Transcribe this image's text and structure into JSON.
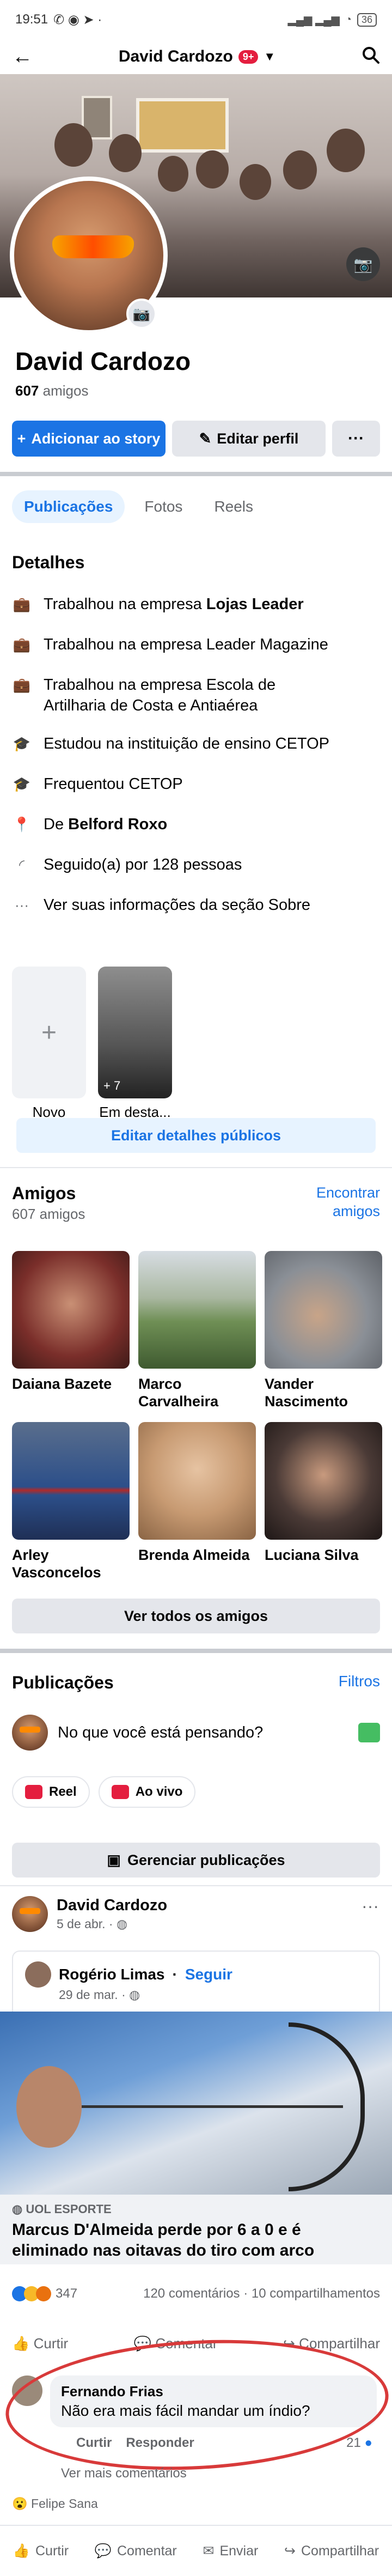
{
  "status_bar": {
    "time": "19:51",
    "battery": "36"
  },
  "nav": {
    "title": "David Cardozo",
    "badge": "9+"
  },
  "profile": {
    "name": "David Cardozo",
    "friend_count": "607",
    "friends_label": "amigos",
    "add_story_label": "Adicionar ao story",
    "edit_profile_label": "Editar perfil",
    "more_label": "···"
  },
  "tabs": [
    {
      "label": "Publicações",
      "active": true
    },
    {
      "label": "Fotos",
      "active": false
    },
    {
      "label": "Reels",
      "active": false
    }
  ],
  "details": {
    "title": "Detalhes",
    "items": [
      {
        "icon": "briefcase-icon",
        "text": "Trabalhou na empresa ",
        "bold": "Lojas Leader"
      },
      {
        "icon": "briefcase-icon",
        "text": "Trabalhou na empresa Leader Magazine",
        "bold": ""
      },
      {
        "icon": "briefcase-icon",
        "text": "Trabalhou na empresa Escola de Artilharia de Costa e Antiaérea",
        "bold": ""
      },
      {
        "icon": "graduation-cap-icon",
        "text": "Estudou na instituição de ensino CETOP",
        "bold": ""
      },
      {
        "icon": "graduation-cap-icon",
        "text": "Frequentou CETOP",
        "bold": ""
      },
      {
        "icon": "location-pin-icon",
        "text": "De ",
        "bold": "Belford Roxo"
      },
      {
        "icon": "rss-icon",
        "text": "Seguido(a) por 128 pessoas",
        "bold": ""
      },
      {
        "icon": "ellipsis-icon",
        "text": "Ver suas informações da seção Sobre",
        "bold": ""
      }
    ]
  },
  "highlights": {
    "items": [
      {
        "label": "Novo",
        "symbol": "+"
      },
      {
        "label": "Em desta...",
        "count": "+ 7"
      }
    ],
    "edit_label": "Editar detalhes públicos"
  },
  "friends": {
    "title": "Amigos",
    "count": "607 amigos",
    "find_label": "Encontrar amigos",
    "see_all_label": "Ver todos os amigos",
    "list": [
      {
        "name": "Daiana Bazete",
        "color": "#7a2e2a"
      },
      {
        "name": "Marco Carvalheira",
        "color": "#6f8f55"
      },
      {
        "name": "Vander Nascimento",
        "color": "#8a8f96"
      },
      {
        "name": "Arley Vasconcelos",
        "color": "#2c4f8a"
      },
      {
        "name": "Brenda Almeida",
        "color": "#c79a72"
      },
      {
        "name": "Luciana Silva",
        "color": "#4a3a36"
      }
    ]
  },
  "posts": {
    "title": "Publicações",
    "filters_label": "Filtros",
    "composer_placeholder": "No que você está pensando?",
    "reel_label": "Reel",
    "live_label": "Ao vivo",
    "manage_label": "Gerenciar publicações",
    "post": {
      "author": "David Cardozo",
      "date": "5 de abr. ·",
      "shared_author": "Rogério Limas",
      "follow_label": "Seguir",
      "shared_date": "29 de mar. ·",
      "source": "UOL ESPORTE",
      "headline": "Marcus D'Almeida perde por 6 a 0 e é eliminado nas oitavas do tiro com arco",
      "reaction_count": "347",
      "comments_shares": "120 comentários · 10 compartilhamentos",
      "actions": [
        "Curtir",
        "Comentar",
        "Compartilhar"
      ],
      "comment": {
        "author": "Fernando Frias",
        "text": "Não era mais fácil mandar um índio?",
        "like_label": "Curtir",
        "reply_label": "Responder",
        "reactions": "21"
      },
      "view_more_label": "Ver mais comentários",
      "typing_user": "Felipe Sana"
    }
  },
  "bottom_bar": {
    "items": [
      "Curtir",
      "Comentar",
      "Enviar",
      "Compartilhar"
    ]
  }
}
